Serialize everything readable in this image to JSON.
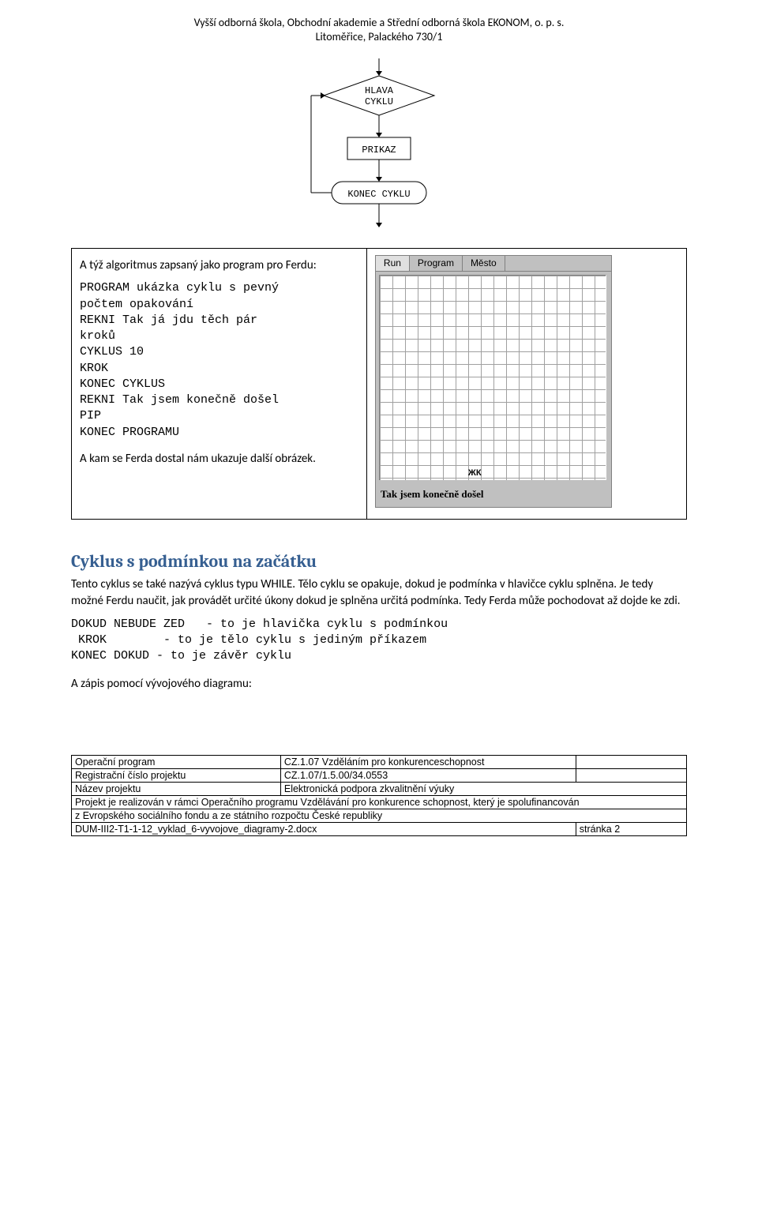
{
  "header": {
    "line1": "Vyšší odborná škola, Obchodní akademie a Střední odborná škola EKONOM, o. p. s.",
    "line2": "Litoměřice, Palackého 730/1"
  },
  "flow": {
    "node1": "HLAVA CYKLU",
    "node2": "PRIKAZ",
    "node3": "KONEC CYKLU"
  },
  "left": {
    "intro": "A týž algoritmus zapsaný jako program pro Ferdu:",
    "code": "PROGRAM ukázka cyklu s pevný\npočtem opakování\nREKNI Tak já jdu těch pár\nkroků\nCYKLUS 10\nKROK\nKONEC CYKLUS\nREKNI Tak jsem konečně došel\nPIP\nKONEC PROGRAMU",
    "outro": "A kam se Ferda dostal nám ukazuje další obrázek."
  },
  "gridapp": {
    "menu1": "Run",
    "menu2": "Program",
    "menu3": "Město",
    "robot": "ЖК",
    "status": "Tak jsem konečně došel"
  },
  "section": {
    "title": "Cyklus s podmínkou na začátku",
    "body": "Tento cyklus se také nazývá cyklus typu WHILE. Tělo cyklu se opakuje, dokud je podmínka v hlavičce cyklu splněna. Je tedy možné Ferdu naučit, jak provádět určité úkony dokud je splněna určitá podmínka. Tedy Ferda může pochodovat až dojde ke zdi.",
    "code": "DOKUD NEBUDE ZED   - to je hlavička cyklu s podmínkou\n KROK        - to je tělo cyklu s jediným příkazem\nKONEC DOKUD - to je závěr cyklu",
    "closing": "A zápis pomocí vývojového diagramu:"
  },
  "footer": {
    "rows": [
      {
        "l": "Operační program",
        "r": "CZ.1.07 Vzděláním pro konkurenceschopnost"
      },
      {
        "l": "Registrační číslo projektu",
        "r": "CZ.1.07/1.5.00/34.0553"
      },
      {
        "l": "Název projektu",
        "r": "Elektronická podpora zkvalitnění výuky"
      }
    ],
    "note1": "Projekt je realizován v rámci Operačního programu Vzdělávání pro konkurence schopnost, který je spolufinancován",
    "note2": "z Evropského sociálního fondu a ze státního rozpočtu České republiky",
    "filename": "DUM-III2-T1-1-12_vyklad_6-vyvojove_diagramy-2.docx",
    "pagenum": "stránka 2"
  }
}
